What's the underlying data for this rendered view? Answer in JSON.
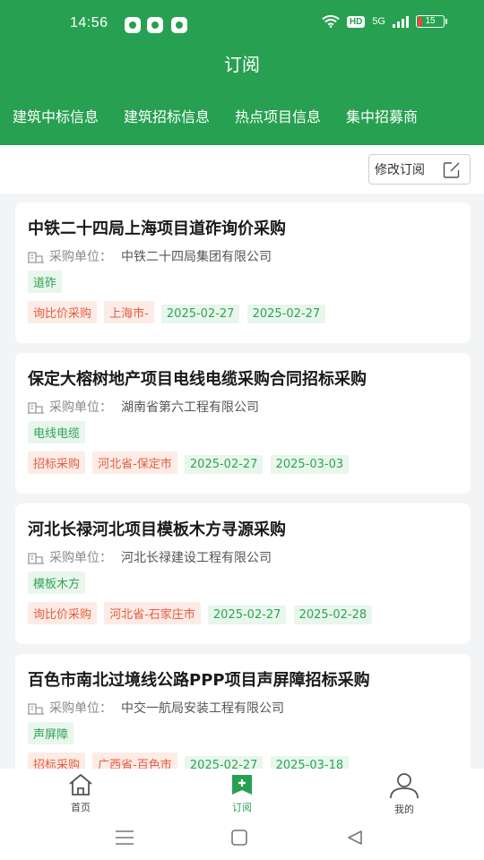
{
  "status_bar": {
    "time": "14:56",
    "network": "5G",
    "hd": "HD",
    "battery": "15"
  },
  "header": {
    "title": "订阅"
  },
  "tabs": [
    "建筑中标信息",
    "建筑招标信息",
    "热点项目信息",
    "集中招募商"
  ],
  "toolbar": {
    "edit_label": "修改订阅"
  },
  "buyer_label": "采购单位：",
  "cards": [
    {
      "title": "中铁二十四局上海项目道砟询价采购",
      "buyer": "中铁二十四局集团有限公司",
      "category": "道砟",
      "type": "询比价采购",
      "region": "上海市-",
      "date1": "2025-02-27",
      "date2": "2025-02-27"
    },
    {
      "title": "保定大榕树地产项目电线电缆采购合同招标采购",
      "buyer": "湖南省第六工程有限公司",
      "category": "电线电缆",
      "type": "招标采购",
      "region": "河北省-保定市",
      "date1": "2025-02-27",
      "date2": "2025-03-03"
    },
    {
      "title": "河北长禄河北项目模板木方寻源采购",
      "buyer": "河北长禄建设工程有限公司",
      "category": "模板木方",
      "type": "询比价采购",
      "region": "河北省-石家庄市",
      "date1": "2025-02-27",
      "date2": "2025-02-28"
    },
    {
      "title": "百色市南北过境线公路PPP项目声屏障招标采购",
      "buyer": "中交一航局安装工程有限公司",
      "category": "声屏障",
      "type": "招标采购",
      "region": "广西省-百色市",
      "date1": "2025-02-27",
      "date2": "2025-03-18"
    }
  ],
  "bottom_nav": {
    "home": "首页",
    "subscribe": "订阅",
    "me": "我的"
  },
  "colors": {
    "brand": "#27a151",
    "tag_green_bg": "#e8f6ec",
    "tag_red_bg": "#fdebe6",
    "tag_red_text": "#e65c3f"
  }
}
